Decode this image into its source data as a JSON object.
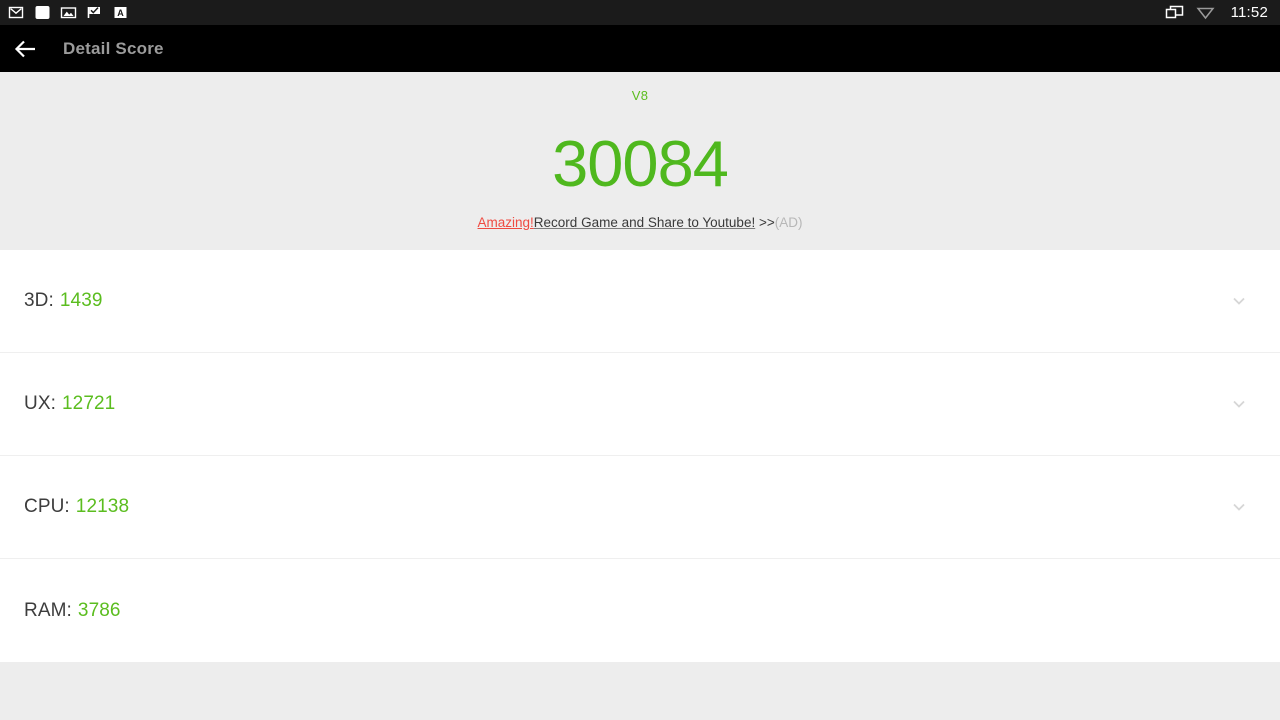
{
  "statusbar": {
    "left_icons": [
      {
        "name": "gmail-icon",
        "label": "Gmail"
      },
      {
        "name": "app-white-square-icon",
        "label": "App"
      },
      {
        "name": "photos-icon",
        "label": "Photos"
      },
      {
        "name": "check-flag-icon",
        "label": "Tasks"
      },
      {
        "name": "letter-a-icon",
        "label": "AnTuTu"
      }
    ],
    "right_icons": [
      {
        "name": "cast-screen-icon",
        "label": "Cast"
      },
      {
        "name": "wifi-icon",
        "label": "Wi-Fi"
      }
    ],
    "clock": "11:52"
  },
  "actionbar": {
    "back_label": "Back",
    "title": "Detail Score"
  },
  "summary": {
    "version": "V8",
    "total_score": "30084",
    "ad": {
      "highlight": "Amazing!",
      "body": "Record Game and Share to Youtube!",
      "arrows": " >>",
      "tag": "(AD)"
    }
  },
  "scores": [
    {
      "label": "3D:",
      "value": "1439",
      "expandable": true
    },
    {
      "label": "UX:",
      "value": "12721",
      "expandable": true
    },
    {
      "label": "CPU:",
      "value": "12138",
      "expandable": true
    },
    {
      "label": "RAM:",
      "value": "3786",
      "expandable": false
    }
  ],
  "colors": {
    "green": "#5bbd1f",
    "score_green": "#4fb81e",
    "ad_red": "#ef4b42",
    "label_gray": "#3d3d3d",
    "title_gray": "#9b9b9b",
    "panel_gray": "#ededed",
    "statusbar_bg": "#1b1b1b",
    "actionbar_bg": "#000000"
  }
}
